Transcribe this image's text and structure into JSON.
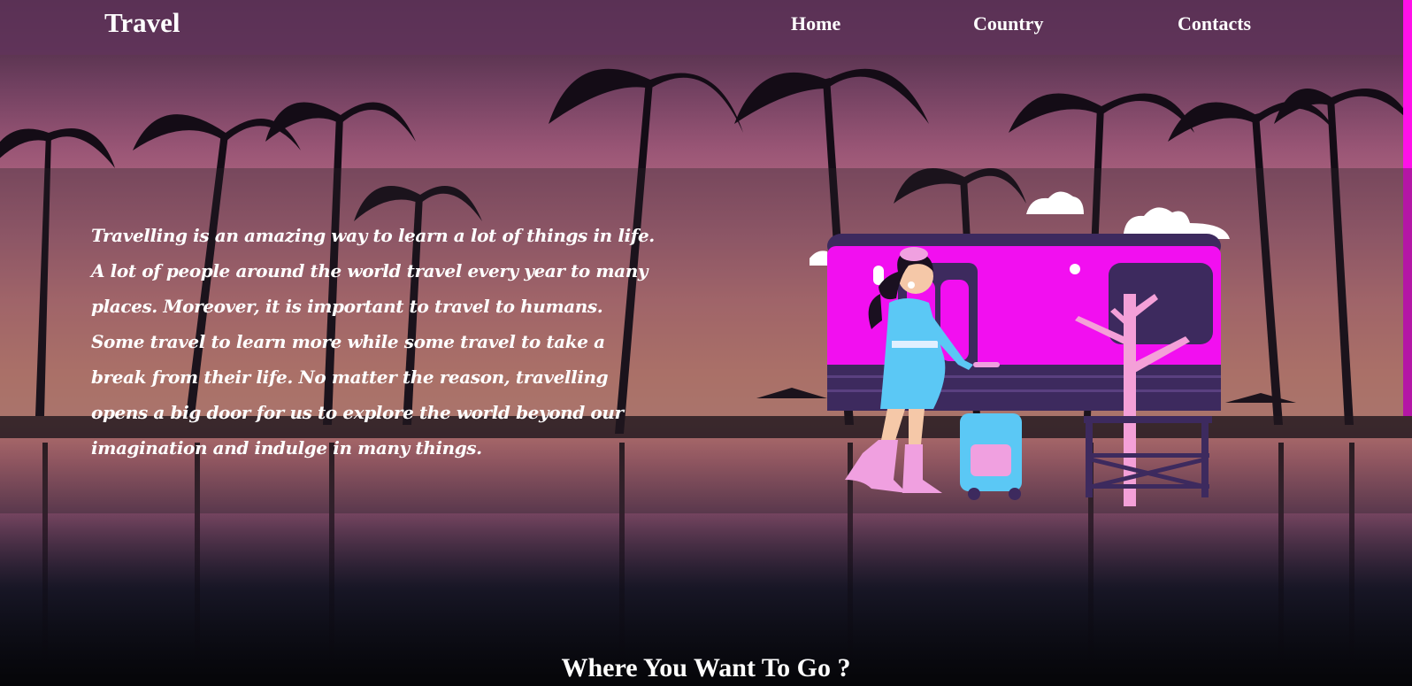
{
  "brand": {
    "title": "Travel"
  },
  "nav": {
    "items": [
      {
        "label": "Home"
      },
      {
        "label": "Country"
      },
      {
        "label": "Contacts"
      }
    ]
  },
  "hero": {
    "paragraph": "Travelling is an amazing way to learn a lot of things in life. A lot of people around the world travel every year to many places. Moreover, it is important to travel to humans. Some travel to learn more while some travel to take a break from their life. No matter the reason, travelling opens a big door for us to explore the world beyond our imagination and indulge in many things."
  },
  "section": {
    "title": "Where You Want To Go ?"
  },
  "colors": {
    "navbar": "#60345a",
    "accent_magenta": "#ff10e8",
    "train_body": "#f20ff0",
    "train_dark": "#3d2a5e",
    "dress": "#5bc8f5",
    "boots": "#f0a0e0"
  },
  "icons": {
    "illustration": "woman-with-suitcase-and-train-illustration"
  }
}
